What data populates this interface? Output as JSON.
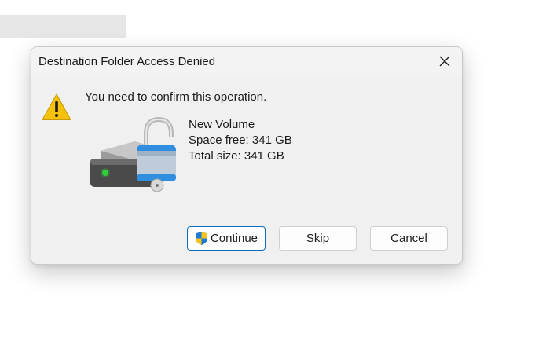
{
  "dialog": {
    "title": "Destination Folder Access Denied",
    "message": "You need to confirm this operation.",
    "volume": {
      "name": "New Volume",
      "space_free": "Space free: 341 GB",
      "total_size": "Total size: 341 GB"
    },
    "buttons": {
      "continue": "Continue",
      "skip": "Skip",
      "cancel": "Cancel"
    },
    "icons": {
      "close": "close-icon",
      "warning": "warning-icon",
      "drive": "locked-drive-icon",
      "uac_shield": "uac-shield-icon"
    }
  },
  "colors": {
    "warning_yellow": "#f4c20d",
    "primary_border": "#0f6cbd",
    "dialog_bg": "#f0f0f0"
  }
}
